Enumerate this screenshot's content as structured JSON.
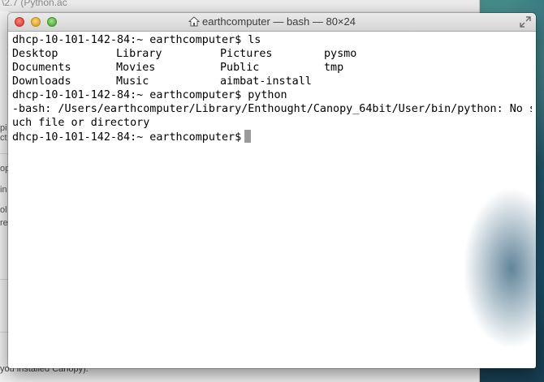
{
  "background_window": {
    "top_text": "\\2.7 (Python.ac",
    "left_fragments": [
      "pi",
      "ct",
      "op",
      "in",
      "ol",
      "re"
    ],
    "bottom_text": "you installed Canopy)."
  },
  "terminal": {
    "title": "earthcomputer — bash — 80×24",
    "lines": [
      {
        "prompt": "dhcp-10-101-142-84:~ earthcomputer$",
        "command": "ls"
      }
    ],
    "ls_rows": [
      [
        "Desktop",
        "Library",
        "Pictures",
        "pysmo"
      ],
      [
        "Documents",
        "Movies",
        "Public",
        "tmp"
      ],
      [
        "Downloads",
        "Music",
        "aimbat-install",
        ""
      ]
    ],
    "python_line": {
      "prompt": "dhcp-10-101-142-84:~ earthcomputer$",
      "command": "python"
    },
    "error_line_1": "-bash: /Users/earthcomputer/Library/Enthought/Canopy_64bit/User/bin/python: No s",
    "error_line_2": "uch file or directory",
    "current_prompt": "dhcp-10-101-142-84:~ earthcomputer$"
  }
}
